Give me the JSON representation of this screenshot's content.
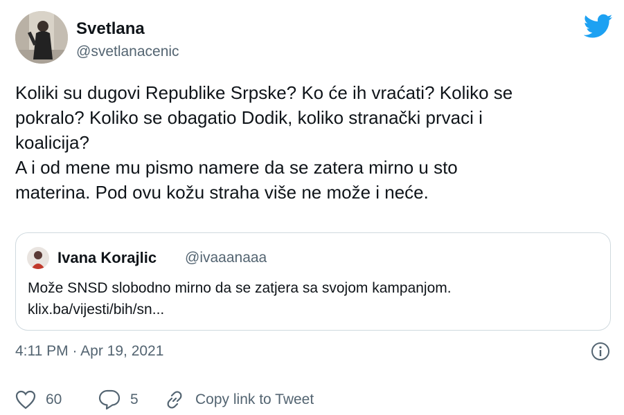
{
  "author": {
    "name": "Svetlana",
    "handle": "@svetlanacenic"
  },
  "tweet": {
    "text": "Koliki su dugovi Republike Srpske? Ko će ih vraćati? Koliko se\npokralo? Koliko se obagatio Dodik, koliko stranački prvaci i\nkoalicija?\nA i od mene mu pismo namere da se zatera mirno u sto\nmaterina. Pod ovu kožu straha više ne može i neće."
  },
  "quoted": {
    "name": "Ivana Korajlic",
    "handle": "@ivaaanaaa",
    "text": "Može SNSD slobodno mirno da se zatjera sa svojom kampanjom.\nklix.ba/vijesti/bih/sn..."
  },
  "timestamp": "4:11 PM · Apr 19, 2021",
  "actions": {
    "likes": "60",
    "replies": "5",
    "copy_link": "Copy link to Tweet"
  },
  "colors": {
    "brand": "#1da1f2",
    "text": "#0f1419",
    "secondary": "#536471",
    "border": "#cfd9de"
  },
  "icons": [
    "twitter-bird-icon",
    "info-icon",
    "heart-icon",
    "reply-bubble-icon",
    "link-icon"
  ]
}
